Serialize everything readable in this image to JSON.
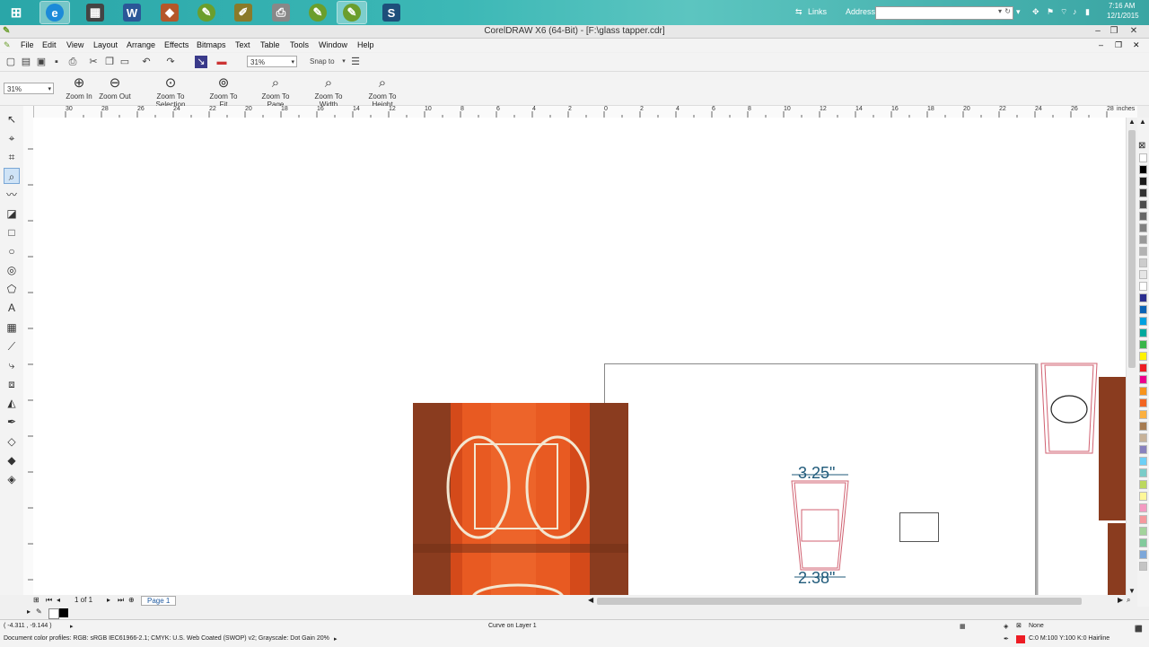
{
  "taskbar": {
    "apps": [
      {
        "icon": "start-icon"
      },
      {
        "icon": "internet-explorer-icon"
      },
      {
        "icon": "calendar-app-icon"
      },
      {
        "icon": "word-icon"
      },
      {
        "icon": "corel-icon"
      },
      {
        "icon": "coreldraw-icon"
      },
      {
        "icon": "pen-app-icon"
      },
      {
        "icon": "printer-icon"
      },
      {
        "icon": "coreldraw-icon-2"
      },
      {
        "icon": "coreldraw-active-icon"
      },
      {
        "icon": "sign-app-icon"
      }
    ],
    "links_label": "Links",
    "address_label": "Address",
    "time": "7:16 AM",
    "date": "12/1/2015"
  },
  "window": {
    "title": "CorelDRAW X6 (64-Bit) - [F:\\glass tapper.cdr]"
  },
  "menu": [
    "File",
    "Edit",
    "View",
    "Layout",
    "Arrange",
    "Effects",
    "Bitmaps",
    "Text",
    "Table",
    "Tools",
    "Window",
    "Help"
  ],
  "toolbar": {
    "zoom_value": "31%",
    "snap_label": "Snap to"
  },
  "propbar": {
    "zoom_value": "31%",
    "zoom_buttons": [
      "Zoom In",
      "Zoom Out",
      "Zoom To Selection",
      "Zoom To Fit",
      "Zoom To Page",
      "Zoom To Width",
      "Zoom To Height"
    ]
  },
  "ruler": {
    "h_labels": [
      "30",
      "28",
      "26",
      "24",
      "22",
      "20",
      "18",
      "16",
      "14",
      "12",
      "10",
      "8",
      "6",
      "4",
      "2",
      "0",
      "2",
      "4",
      "6",
      "8",
      "10",
      "12",
      "14",
      "16",
      "18",
      "20",
      "22",
      "24",
      "26",
      "28"
    ],
    "units": "inches"
  },
  "canvas": {
    "dim_top": "3.25\"",
    "dim_bottom": "2.38\""
  },
  "pagenav": {
    "count": "1 of 1",
    "tab": "Page 1"
  },
  "status": {
    "coords": "( -4.311 , -9.144 )",
    "object_info": "Curve on Layer 1",
    "fill": "None",
    "outline": "C:0 M:100 Y:100 K:0  Hairline",
    "color_profiles": "Document color profiles: RGB: sRGB IEC61966-2.1; CMYK: U.S. Web Coated (SWOP) v2; Grayscale: Dot Gain 20%"
  },
  "palette_colors": [
    "#ffffff",
    "#000000",
    "#1a1a1a",
    "#333333",
    "#4d4d4d",
    "#666666",
    "#808080",
    "#999999",
    "#b3b3b3",
    "#cccccc",
    "#e6e6e6",
    "#ffffff",
    "#2b2e8f",
    "#0a63b5",
    "#00a0e0",
    "#00a99d",
    "#39b54a",
    "#fff200",
    "#ed1c24",
    "#ec008c",
    "#f7941d",
    "#f26522",
    "#fbb040",
    "#a67c52",
    "#c7b299",
    "#8781bd",
    "#6dcff6",
    "#7accc8",
    "#bcd85f",
    "#fff799",
    "#f49ac2",
    "#f5989d",
    "#a3d39c",
    "#82ca9c",
    "#7da7d9",
    "#c4c4c4"
  ]
}
